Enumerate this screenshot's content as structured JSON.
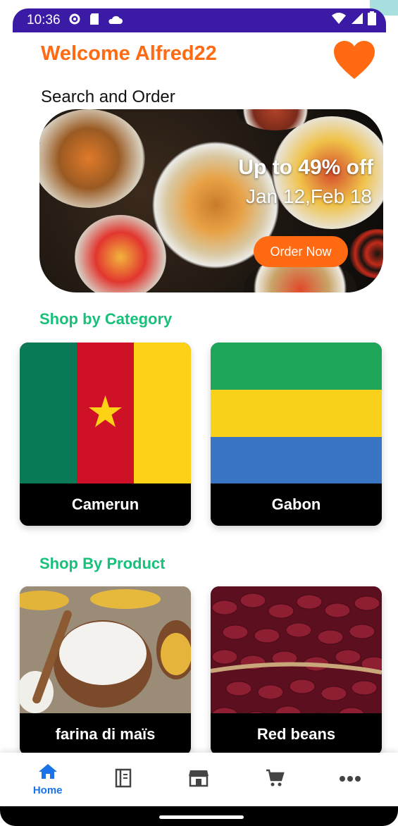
{
  "status_bar": {
    "time": "10:36"
  },
  "header": {
    "welcome": "Welcome Alfred22"
  },
  "subtitle": "Search and Order",
  "banner": {
    "promo": "Up to 49% off",
    "dates": "Jan 12,Feb 18",
    "cta": "Order Now"
  },
  "categories": {
    "title": "Shop by Category",
    "items": [
      {
        "label": "Camerun"
      },
      {
        "label": "Gabon"
      }
    ]
  },
  "products": {
    "title": "Shop By Product",
    "items": [
      {
        "label": "farina di maïs"
      },
      {
        "label": "Red beans"
      }
    ]
  },
  "nav": {
    "home": "Home"
  },
  "colors": {
    "accent": "#ff6a13",
    "section": "#18c07a",
    "nav_active": "#1a73e8",
    "status_bar": "#3b1aa6"
  }
}
